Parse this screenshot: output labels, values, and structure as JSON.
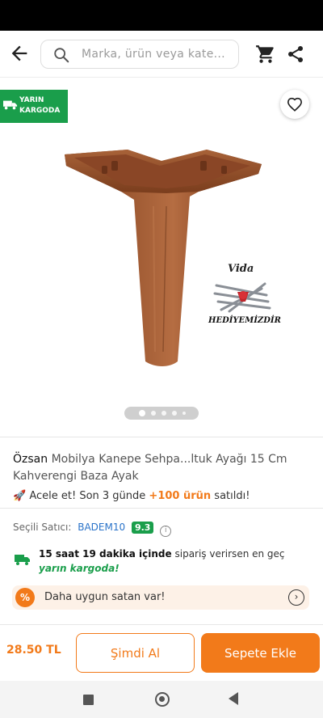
{
  "header": {
    "search_placeholder": "Marka, ürün veya kate..."
  },
  "media": {
    "shipping_badge_line1": "YARIN",
    "shipping_badge_line2": "KARGODA",
    "gift_label_top": "Vida",
    "gift_label_bottom": "HEDİYEMİZDİR",
    "image_count": 5,
    "active_image_index": 0
  },
  "product": {
    "brand": "Özsan",
    "name": "Mobilya Kanepe Sehpa...ltuk Ayağı 15 Cm Kahverengi Baza Ayak",
    "urgency_prefix": "Acele et! Son 3 günde",
    "urgency_highlight": "+100 ürün",
    "urgency_suffix": "satıldı!"
  },
  "seller": {
    "label": "Seçili Satıcı:",
    "name": "BADEM10",
    "score": "9.3"
  },
  "delivery": {
    "time_bold": "15 saat 19 dakika içinde",
    "middle": "sipariş verirsen en geç",
    "green": "yarın kargoda!"
  },
  "cheaper": {
    "text": "Daha uygun satan var!"
  },
  "footer": {
    "price": "28.50 TL",
    "buy_now_label": "Şimdi Al",
    "add_to_cart_label": "Sepete Ekle"
  },
  "colors": {
    "accent": "#f27a1a",
    "success": "#1a9e4b",
    "link": "#2a73c9"
  }
}
